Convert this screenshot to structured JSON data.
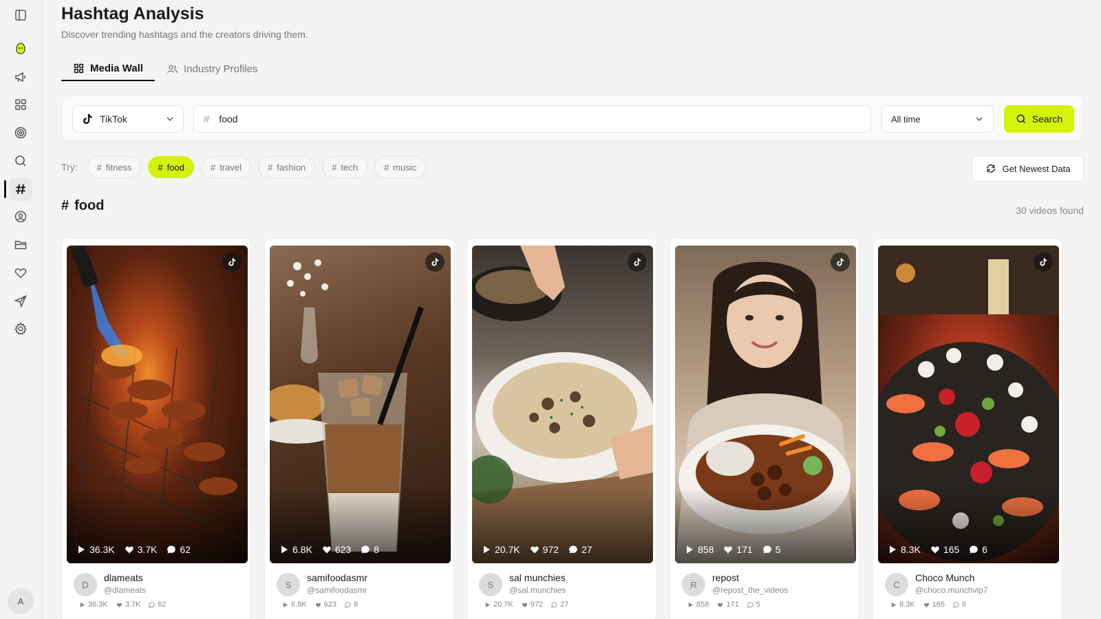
{
  "page": {
    "title": "Hashtag Analysis",
    "subtitle": "Discover trending hashtags and the creators driving them."
  },
  "tabs": [
    {
      "label": "Media Wall",
      "active": true,
      "icon": "grid-icon"
    },
    {
      "label": "Industry Profiles",
      "active": false,
      "icon": "users-icon"
    }
  ],
  "search": {
    "platform": "TikTok",
    "hashtag_value": "food",
    "hashtag_prefix": "#",
    "time_range": "All time",
    "search_label": "Search"
  },
  "try_label": "Try:",
  "suggestions": [
    "fitness",
    "food",
    "travel",
    "fashion",
    "tech",
    "music"
  ],
  "active_suggestion": "food",
  "newest_label": "Get Newest Data",
  "results": {
    "hashtag": "food",
    "count_label": "30 videos found"
  },
  "sidebar": {
    "avatar_initial": "A",
    "items": [
      "panel-toggle-icon",
      "logo-icon",
      "megaphone-icon",
      "dashboard-icon",
      "target-icon",
      "search-icon",
      "hashtag-icon",
      "user-icon",
      "folder-icon",
      "heart-icon",
      "send-icon",
      "gear-icon"
    ],
    "active": "hashtag-icon"
  },
  "videos": [
    {
      "initial": "D",
      "name": "dlameats",
      "handle": "@dlameats",
      "views": "36.3K",
      "likes": "3.7K",
      "comments": "62"
    },
    {
      "initial": "S",
      "name": "samifoodasmr",
      "handle": "@samifoodasmr",
      "views": "6.8K",
      "likes": "623",
      "comments": "8"
    },
    {
      "initial": "S",
      "name": "sal munchies",
      "handle": "@sal.munchies",
      "views": "20.7K",
      "likes": "972",
      "comments": "27"
    },
    {
      "initial": "R",
      "name": "repost",
      "handle": "@repost_the_videos",
      "views": "858",
      "likes": "171",
      "comments": "5"
    },
    {
      "initial": "C",
      "name": "Choco Munch",
      "handle": "@choco.munchvip7",
      "views": "8.3K",
      "likes": "165",
      "comments": "6"
    }
  ],
  "colors": {
    "accent": "#d4f20c",
    "background": "#f4f4f4",
    "text": "#1a1a1a"
  }
}
